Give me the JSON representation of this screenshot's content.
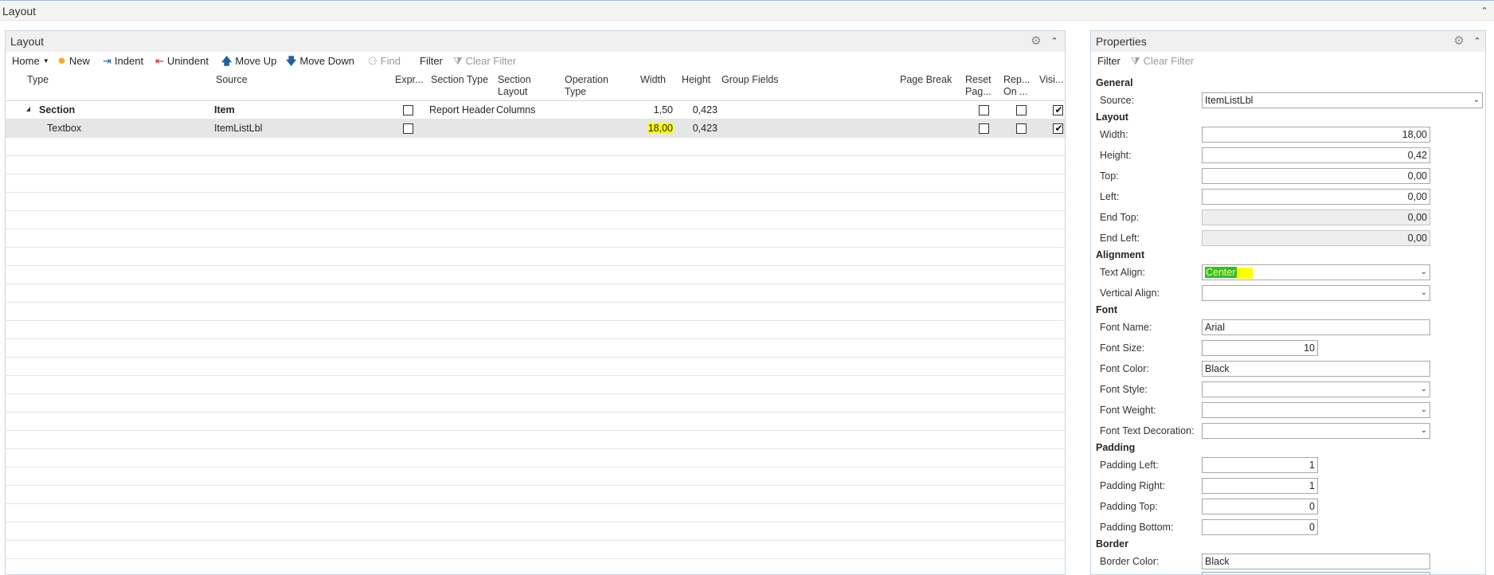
{
  "page": {
    "title": "Layout"
  },
  "layout_panel": {
    "title": "Layout",
    "toolbar": {
      "home": "Home",
      "new": "New",
      "indent": "Indent",
      "unindent": "Unindent",
      "move_up": "Move Up",
      "move_down": "Move Down",
      "find": "Find",
      "filter": "Filter",
      "clear_filter": "Clear Filter"
    },
    "columns": {
      "type": "Type",
      "source": "Source",
      "expr": "Expr...",
      "section_type": "Section Type",
      "section_layout_1": "Section",
      "section_layout_2": "Layout",
      "operation_type_1": "Operation",
      "operation_type_2": "Type",
      "width": "Width",
      "height": "Height",
      "group_fields": "Group Fields",
      "page_break": "Page Break",
      "reset_page_1": "Reset",
      "reset_page_2": "Pag...",
      "repeat_on_1": "Rep...",
      "repeat_on_2": "On ...",
      "visible": "Visi..."
    },
    "rows": [
      {
        "type": "Section",
        "source": "Item",
        "expr": false,
        "section_type": "Report Header",
        "section_layout": "Columns",
        "width": "1,50",
        "height": "0,423",
        "reset_page": false,
        "repeat_on": false,
        "visible": true
      },
      {
        "type": "Textbox",
        "source": "ItemListLbl",
        "expr": false,
        "section_type": "",
        "section_layout": "",
        "width": "18,00",
        "height": "0,423",
        "reset_page": false,
        "repeat_on": false,
        "visible": true
      }
    ]
  },
  "properties_panel": {
    "title": "Properties",
    "toolbar": {
      "filter": "Filter",
      "clear_filter": "Clear Filter"
    },
    "general": {
      "heading": "General",
      "source_label": "Source:",
      "source_value": "ItemListLbl"
    },
    "layout": {
      "heading": "Layout",
      "width_label": "Width:",
      "width_value": "18,00",
      "height_label": "Height:",
      "height_value": "0,42",
      "top_label": "Top:",
      "top_value": "0,00",
      "left_label": "Left:",
      "left_value": "0,00",
      "end_top_label": "End Top:",
      "end_top_value": "0,00",
      "end_left_label": "End Left:",
      "end_left_value": "0,00"
    },
    "alignment": {
      "heading": "Alignment",
      "text_align_label": "Text Align:",
      "text_align_value": "Center",
      "vertical_align_label": "Vertical Align:",
      "vertical_align_value": ""
    },
    "font": {
      "heading": "Font",
      "name_label": "Font Name:",
      "name_value": "Arial",
      "size_label": "Font Size:",
      "size_value": "10",
      "color_label": "Font Color:",
      "color_value": "Black",
      "style_label": "Font Style:",
      "style_value": "",
      "weight_label": "Font Weight:",
      "weight_value": "",
      "decoration_label": "Font Text Decoration:",
      "decoration_value": ""
    },
    "padding": {
      "heading": "Padding",
      "left_label": "Padding Left:",
      "left_value": "1",
      "right_label": "Padding Right:",
      "right_value": "1",
      "top_label": "Padding Top:",
      "top_value": "0",
      "bottom_label": "Padding Bottom:",
      "bottom_value": "0"
    },
    "border": {
      "heading": "Border",
      "color_label": "Border Color:",
      "color_value": "Black"
    }
  },
  "icons": {
    "new": "sun-icon",
    "indent": "indent-icon",
    "unindent": "unindent-icon",
    "move_up": "arrow-up-icon",
    "move_down": "arrow-down-icon",
    "find": "binoculars-icon",
    "clear_filter": "clear-filter-icon",
    "settings": "gear-icon"
  },
  "colors": {
    "highlight": "#ffff00",
    "selection": "#2fbf2f",
    "selected_row": "#e6e6e6",
    "move_arrows": "#1e5fa8",
    "new_icon": "#f5a623",
    "unindent_x": "#d02020"
  }
}
